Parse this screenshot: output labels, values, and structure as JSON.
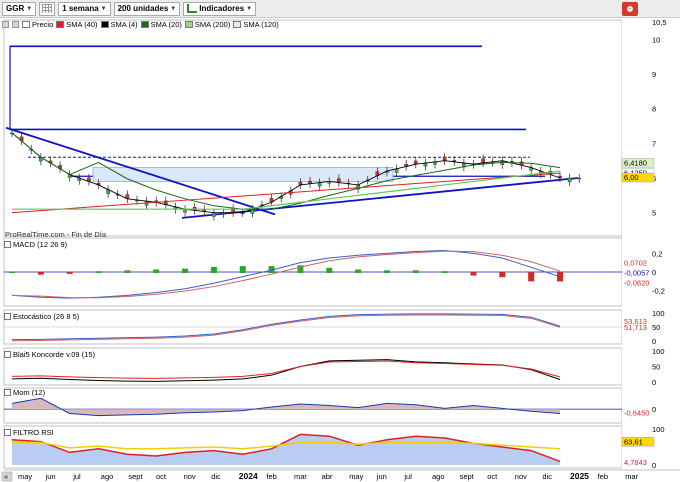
{
  "toolbar": {
    "symbol": "GGR",
    "period": "1 semana",
    "units": "200 unidades",
    "indicators": "Indicadores"
  },
  "legend": [
    {
      "label": "Precio",
      "color": "#ffffff"
    },
    {
      "label": "SMA (40)",
      "color": "#e02020"
    },
    {
      "label": "SMA (4)",
      "color": "#000000"
    },
    {
      "label": "SMA (20)",
      "color": "#1a6a1a"
    },
    {
      "label": "SMA (200)",
      "color": "#a7d47a"
    },
    {
      "label": "SMA (120)",
      "color": "#e9e9e9"
    }
  ],
  "watermark": "ProRealTime.com - Fin de Día",
  "panels": {
    "macd": "MACD (12 26 9)",
    "stoch": "Estocástico (26 8 5)",
    "blai5": "Blai5 Koncorde v.09 (15)",
    "mom": "Mom (12)",
    "rsi": "FILTRO RSI"
  },
  "price_axis": [
    "10,5",
    "10",
    "9",
    "8",
    "7",
    "6",
    "5"
  ],
  "price_tags": [
    "6,4180",
    "6,1250",
    "6,00"
  ],
  "macd_axis": [
    "0,2",
    "0",
    "-0,2"
  ],
  "macd_tags": [
    "0,0702",
    "-0,0057",
    "-0,0820"
  ],
  "stoch_axis": [
    "100",
    "50",
    "0"
  ],
  "stoch_tags": [
    "53,613",
    "51,713"
  ],
  "blai5_axis": [
    "100",
    "50",
    "0"
  ],
  "mom_axis": [
    "0"
  ],
  "mom_tags": [
    "-0,6450"
  ],
  "rsi_axis": [
    "100",
    "0"
  ],
  "rsi_tags": [
    "63,61",
    "4,7843"
  ],
  "x_labels": [
    "may",
    "jun",
    "jul",
    "ago",
    "sept",
    "oct",
    "nov",
    "dic",
    "2024",
    "feb",
    "mar",
    "abr",
    "may",
    "jun",
    "jul",
    "ago",
    "sept",
    "oct",
    "nov",
    "dic",
    "2025",
    "feb",
    "mar"
  ],
  "chart_data": {
    "type": "candlestick",
    "title": "GGR",
    "price_ylim": [
      4.5,
      10.5
    ],
    "x": [
      "2023-05",
      "2023-06",
      "2023-07",
      "2023-08",
      "2023-09",
      "2023-10",
      "2023-11",
      "2023-12",
      "2024-01",
      "2024-02",
      "2024-03",
      "2024-04",
      "2024-05",
      "2024-06",
      "2024-07",
      "2024-08",
      "2024-09",
      "2024-10",
      "2024-11",
      "2024-12"
    ],
    "close_approx": [
      7.3,
      6.6,
      6.1,
      5.8,
      5.4,
      5.3,
      5.1,
      5.0,
      5.0,
      5.3,
      5.8,
      5.9,
      5.8,
      6.2,
      6.4,
      6.5,
      6.4,
      6.5,
      6.3,
      6.0
    ],
    "horizontal_levels": [
      9.8,
      7.4,
      6.6,
      6.0
    ],
    "last_price": 6.0
  }
}
